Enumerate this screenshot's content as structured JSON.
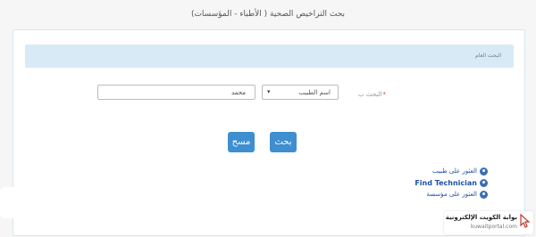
{
  "page": {
    "title": "بحث التراخيص الصحية ( الأطباء - المؤسسات)"
  },
  "form": {
    "section_title": "البحث العام",
    "search_by_label": "البحث ب",
    "required_mark": "*",
    "select_value": "اسم الطبيب",
    "input_value": "محمد"
  },
  "buttons": {
    "search": "بحث",
    "clear": "مسح"
  },
  "links": [
    {
      "label": "العثور على طبيب",
      "icon": "doctor-icon"
    },
    {
      "label": "Find Technician",
      "icon": "technician-icon"
    },
    {
      "label": "العثور على مؤسسة",
      "icon": "building-icon"
    }
  ],
  "portal": {
    "name": "بوابة الكويت الإلكترونية",
    "url": "kuwaitportal.com"
  }
}
